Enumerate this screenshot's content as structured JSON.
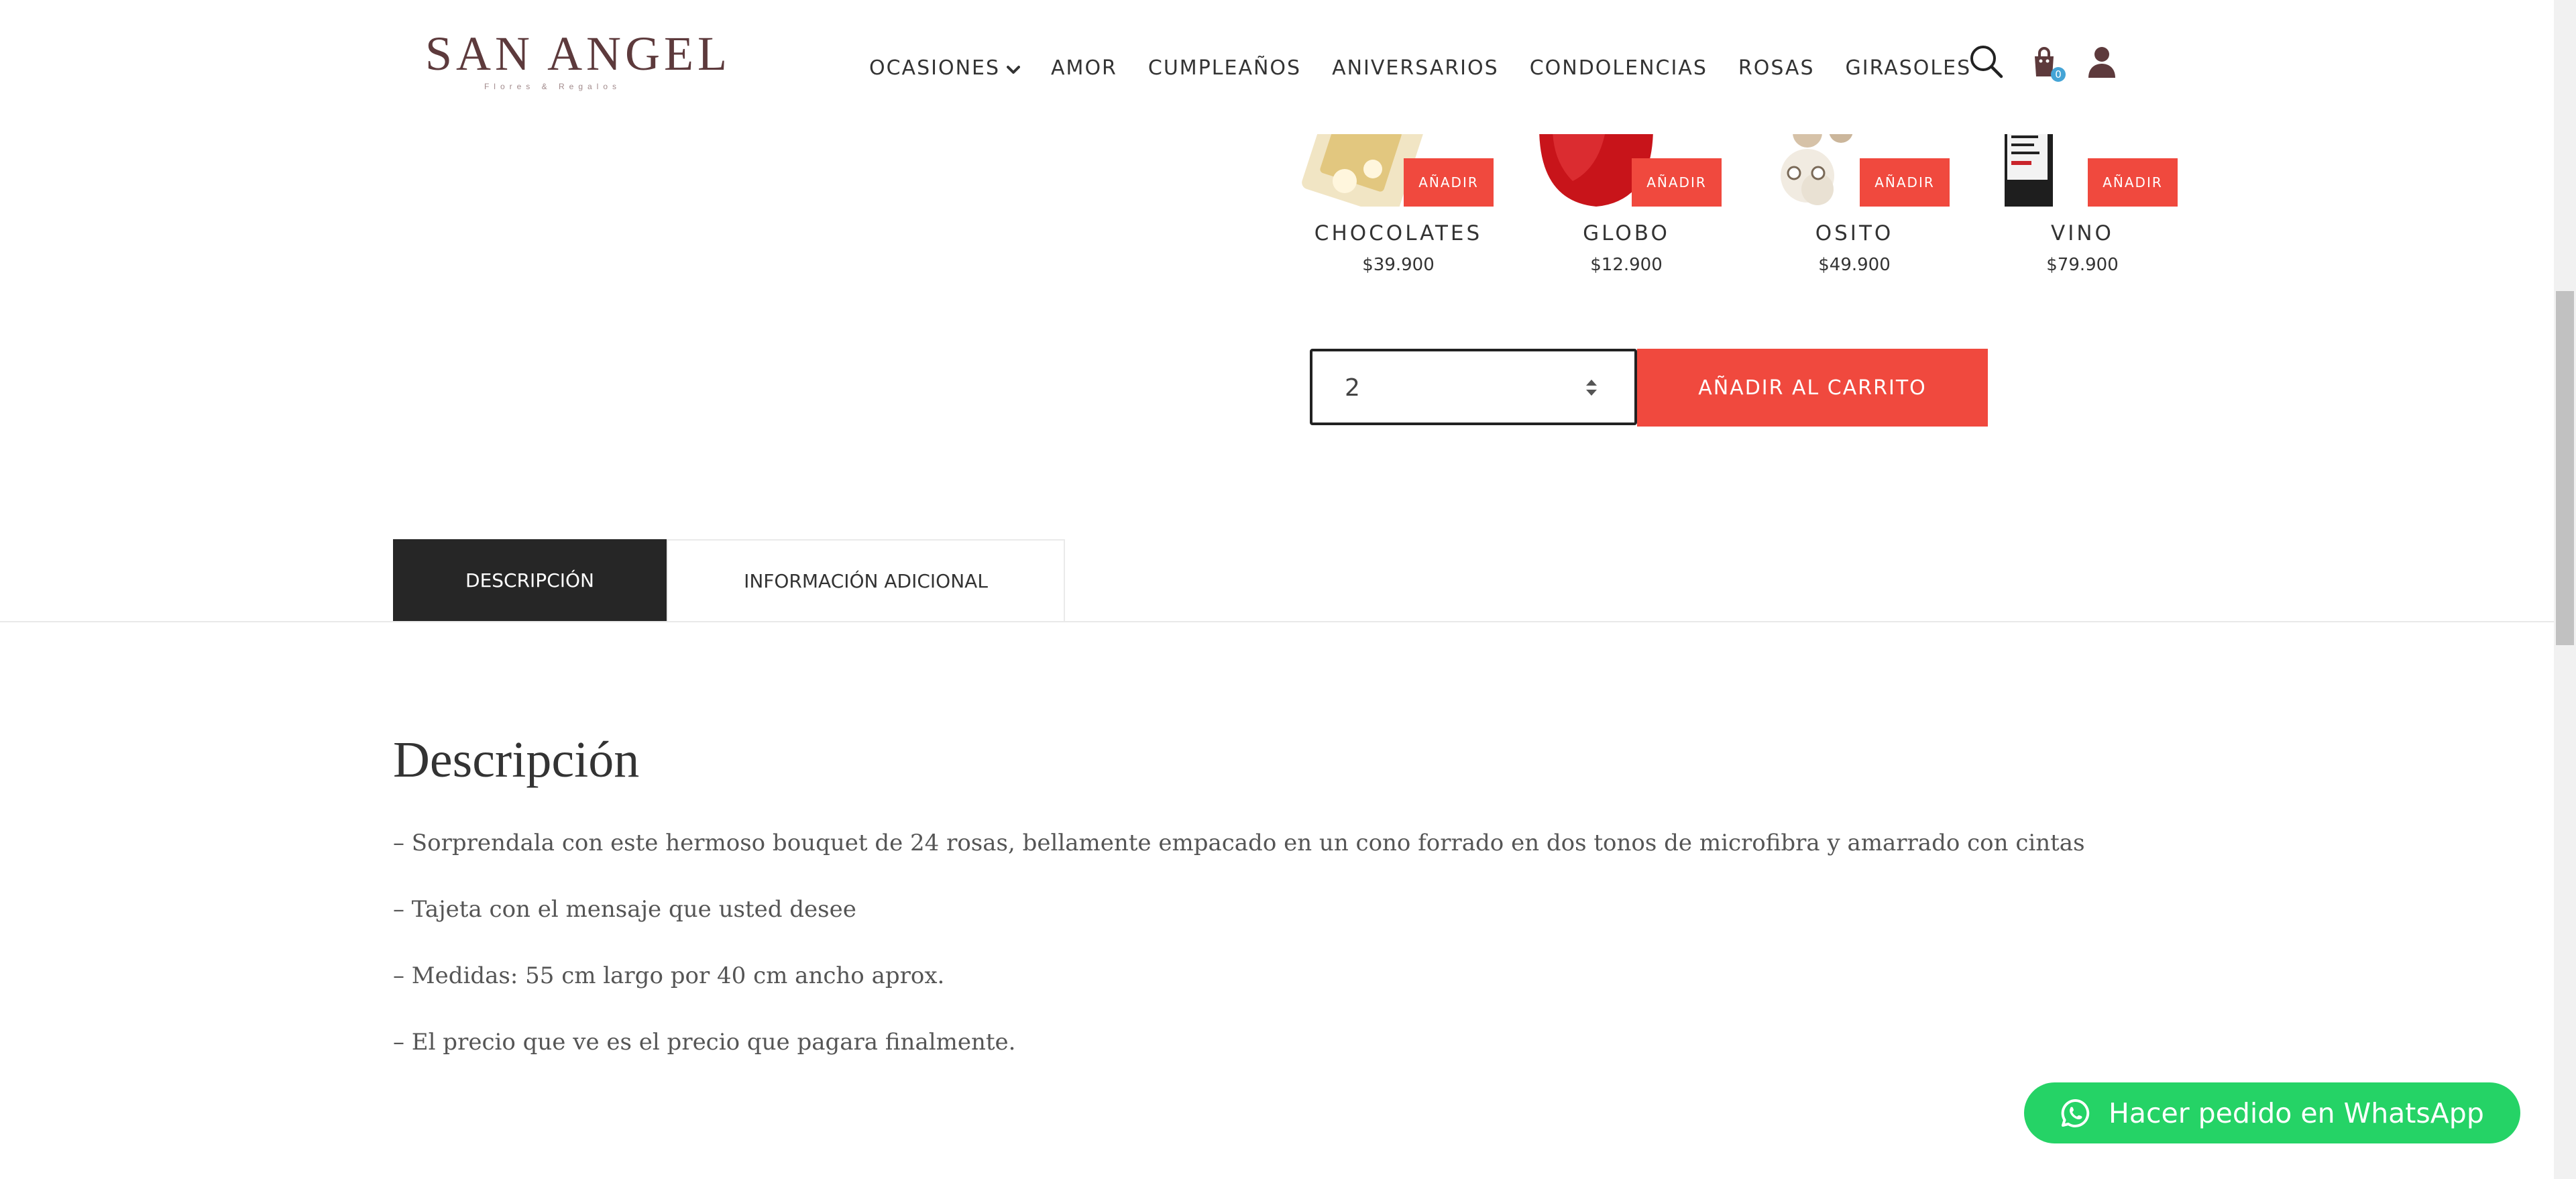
{
  "brand": {
    "name": "SAN ANGEL",
    "tagline": "Flores & Regalos",
    "colors": {
      "primary": "#5d3a3c",
      "accent": "#f0493e",
      "dark_tab": "#262626",
      "whatsapp": "#25d366"
    }
  },
  "nav": {
    "items": [
      {
        "label": "OCASIONES",
        "has_dropdown": true
      },
      {
        "label": "AMOR"
      },
      {
        "label": "CUMPLEAÑOS"
      },
      {
        "label": "ANIVERSARIOS"
      },
      {
        "label": "CONDOLENCIAS"
      },
      {
        "label": "ROSAS"
      },
      {
        "label": "GIRASOLES"
      }
    ],
    "icons": {
      "search": "search-icon",
      "cart": "shopping-bag-icon",
      "account": "user-icon"
    },
    "cart_count": "0"
  },
  "addons": [
    {
      "name": "CHOCOLATES",
      "price": "$39.900",
      "button": "AÑADIR"
    },
    {
      "name": "GLOBO",
      "price": "$12.900",
      "button": "AÑADIR"
    },
    {
      "name": "OSITO",
      "price": "$49.900",
      "button": "AÑADIR"
    },
    {
      "name": "VINO",
      "price": "$79.900",
      "button": "AÑADIR"
    }
  ],
  "purchase": {
    "quantity": "2",
    "add_to_cart": "AÑADIR AL CARRITO"
  },
  "tabs": [
    {
      "label": "DESCRIPCIÓN",
      "active": true
    },
    {
      "label": "INFORMACIÓN ADICIONAL",
      "active": false
    }
  ],
  "description": {
    "title": "Descripción",
    "lines": [
      "– Sorprendala con este hermoso bouquet de 24 rosas, bellamente empacado en un cono forrado en dos tonos de microfibra y amarrado con cintas",
      "– Tajeta con el mensaje que usted desee",
      "– Medidas: 55 cm largo por 40 cm ancho aprox.",
      "– El precio que ve es el precio que pagara finalmente."
    ]
  },
  "whatsapp": {
    "label": "Hacer pedido en WhatsApp",
    "icon": "whatsapp-icon"
  }
}
